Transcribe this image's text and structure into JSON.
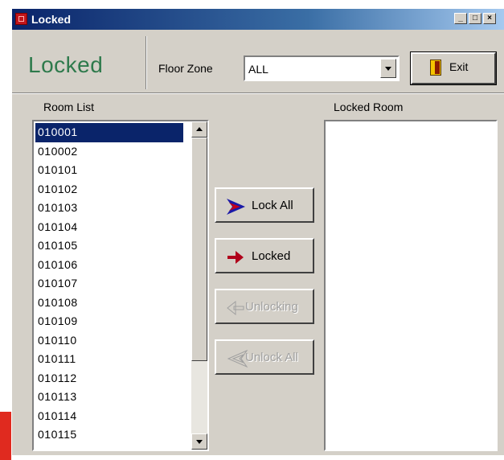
{
  "window": {
    "title": "Locked",
    "controls": [
      "_",
      "□",
      "×"
    ]
  },
  "header": {
    "big_title": "Locked",
    "floor_zone_label": "Floor Zone",
    "floor_zone_value": "ALL",
    "exit_label": "Exit"
  },
  "room_list": {
    "label": "Room List",
    "items": [
      "010001",
      "010002",
      "010101",
      "010102",
      "010103",
      "010104",
      "010105",
      "010106",
      "010107",
      "010108",
      "010109",
      "010110",
      "010111",
      "010112",
      "010113",
      "010114",
      "010115"
    ],
    "selected": "010001"
  },
  "locked_room": {
    "label": "Locked Room",
    "items": []
  },
  "actions": {
    "lock_all": "Lock All",
    "locked": "Locked",
    "unlocking": "Unlocking",
    "unlock_all": "Unlock All"
  }
}
